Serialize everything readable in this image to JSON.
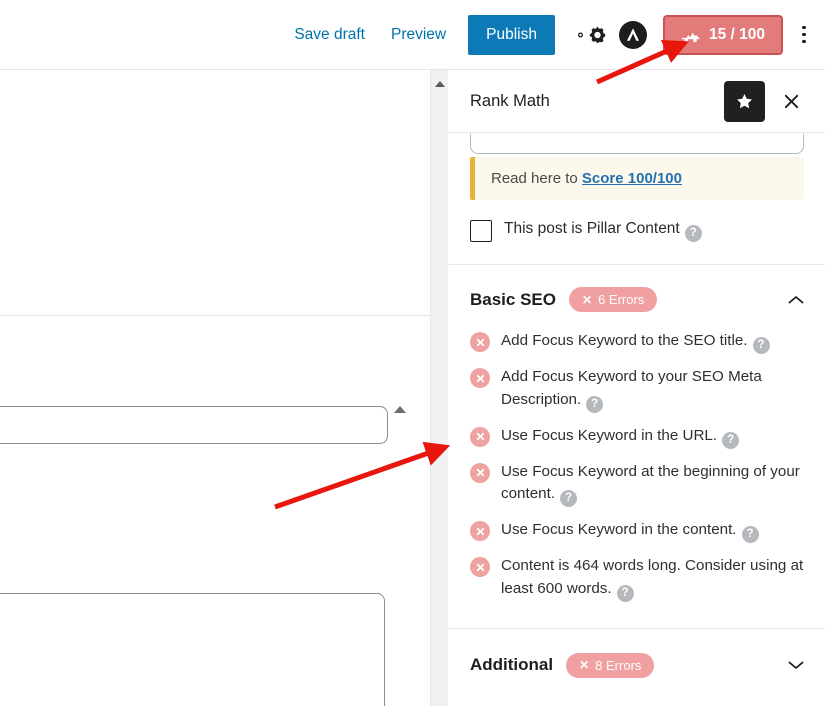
{
  "topbar": {
    "save_draft_label": "Save draft",
    "preview_label": "Preview",
    "publish_label": "Publish",
    "settings_icon": "gear-icon",
    "plugin_icon": "rank-math-logo-icon",
    "score_badge": {
      "icon": "seo-score-truck-icon",
      "label": "15 / 100",
      "value": 15,
      "max": 100,
      "background": "#e37b7b",
      "border": "#cc5252",
      "text_color": "#ffffff"
    },
    "more_options_icon": "kebab-menu-icon",
    "publish_color": "#0d7ab7",
    "link_color": "#0073aa"
  },
  "sidebar": {
    "title": "Rank Math",
    "star_button_icon": "star-icon",
    "close_button_icon": "close-icon",
    "notice": {
      "prefix": "Read here to ",
      "link_label": "Score 100/100"
    },
    "pillar": {
      "label": "This post is Pillar Content",
      "checked": false,
      "help_icon": "help-icon",
      "help_glyph": "?"
    },
    "sections": [
      {
        "title": "Basic SEO",
        "errors_label": "6 Errors",
        "error_count": 6,
        "expanded": true,
        "toggle_icon": "chevron-up-icon",
        "items": [
          {
            "status": "error",
            "text": "Add Focus Keyword to the SEO title.",
            "help_glyph": "?"
          },
          {
            "status": "error",
            "text": "Add Focus Keyword to your SEO Meta Description.",
            "help_glyph": "?"
          },
          {
            "status": "error",
            "text": "Use Focus Keyword in the URL.",
            "help_glyph": "?"
          },
          {
            "status": "error",
            "text": "Use Focus Keyword at the beginning of your content.",
            "help_glyph": "?"
          },
          {
            "status": "error",
            "text": "Use Focus Keyword in the content.",
            "help_glyph": "?"
          },
          {
            "status": "error",
            "text": "Content is 464 words long. Consider using at least 600 words.",
            "help_glyph": "?"
          }
        ]
      },
      {
        "title": "Additional",
        "errors_label": "8 Errors",
        "error_count": 8,
        "expanded": false,
        "toggle_icon": "chevron-down-icon",
        "items": []
      }
    ],
    "error_pill_color": "#f0a0a0",
    "notice_accent_color": "#e8b33c",
    "notice_bg_color": "#fdf8ec"
  },
  "editor": {
    "scrollbar_up_icon": "scroll-up-arrow-icon",
    "block_collapse_icon": "collapse-caret-icon"
  },
  "annotations": {
    "arrow_color": "#e8160c",
    "arrows": [
      {
        "name": "arrow-to-score-badge"
      },
      {
        "name": "arrow-to-seo-checklist"
      }
    ]
  }
}
